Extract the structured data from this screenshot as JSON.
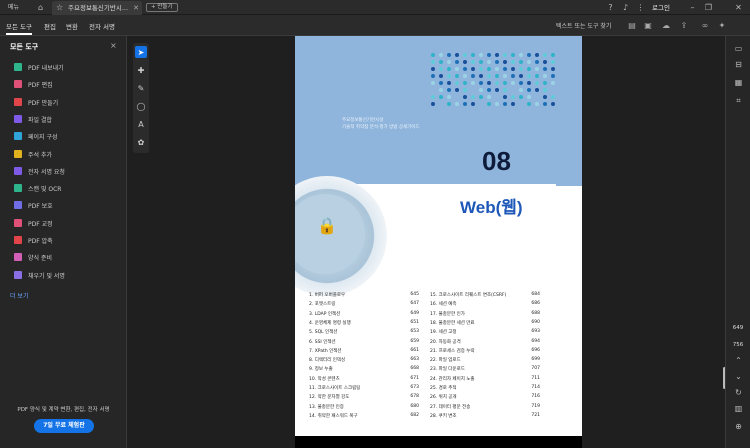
{
  "titlebar": {
    "menu_label": "메뉴",
    "tab_title": "주요정보통신기반시...",
    "new_label": "+ 만들기",
    "login_label": "로그인"
  },
  "toolbar": {
    "tabs": [
      "모든 도구",
      "편집",
      "변환",
      "전자 서명"
    ],
    "search_label": "텍스트 또는 도구 찾기"
  },
  "sidebar": {
    "title": "모든 도구",
    "items": [
      {
        "label": "PDF 내보내기",
        "color": "#2fb58b"
      },
      {
        "label": "PDF 편집",
        "color": "#e0517a"
      },
      {
        "label": "PDF 만들기",
        "color": "#e0454a"
      },
      {
        "label": "파일 결합",
        "color": "#7f5ae6"
      },
      {
        "label": "페이지 구성",
        "color": "#2fa4d8"
      },
      {
        "label": "주석 추가",
        "color": "#e0b21e"
      },
      {
        "label": "전자 서명 요청",
        "color": "#7f5ae6"
      },
      {
        "label": "스캔 및 OCR",
        "color": "#2fb58b"
      },
      {
        "label": "PDF 보호",
        "color": "#6f6ee6"
      },
      {
        "label": "PDF 교정",
        "color": "#e0517a"
      },
      {
        "label": "PDF 압축",
        "color": "#e0454a"
      },
      {
        "label": "양식 준비",
        "color": "#d15fb6"
      },
      {
        "label": "채우기 및 서명",
        "color": "#8a6ee6"
      }
    ],
    "more_label": "더 보기",
    "promo_text": "PDF 양식 및 계약 변환, 편집, 전자 서명",
    "trial_button": "7일 무료 체험판"
  },
  "page": {
    "category_line1": "주요정보통신기반시설",
    "category_line2": "기술적 취약점 분석·평가 방법 상세가이드",
    "chapter_number": "08",
    "chapter_title": "Web(웹)",
    "toc_left": [
      {
        "t": "1. 버퍼 오버플로우",
        "p": "645"
      },
      {
        "t": "2. 포맷스트링",
        "p": "647"
      },
      {
        "t": "3. LDAP 인젝션",
        "p": "649"
      },
      {
        "t": "4. 운영체제 명령 실행",
        "p": "651"
      },
      {
        "t": "5. SQL 인젝션",
        "p": "653"
      },
      {
        "t": "6. SSI 인젝션",
        "p": "659"
      },
      {
        "t": "7. XPath 인젝션",
        "p": "661"
      },
      {
        "t": "8. 디렉터리 인덱싱",
        "p": "663"
      },
      {
        "t": "9. 정보 누출",
        "p": "668"
      },
      {
        "t": "10. 악성 콘텐츠",
        "p": "671"
      },
      {
        "t": "11. 크로스사이트 스크립팅",
        "p": "673"
      },
      {
        "t": "12. 약한 문자열 강도",
        "p": "678"
      },
      {
        "t": "13. 불충분한 인증",
        "p": "680"
      },
      {
        "t": "14. 취약한 패스워드 복구",
        "p": "682"
      }
    ],
    "toc_right": [
      {
        "t": "15. 크로스사이트 리퀘스트 변조(CSRF)",
        "p": "684"
      },
      {
        "t": "16. 세션 예측",
        "p": "686"
      },
      {
        "t": "17. 불충분한 인가",
        "p": "688"
      },
      {
        "t": "18. 불충분한 세션 만료",
        "p": "690"
      },
      {
        "t": "19. 세션 고정",
        "p": "693"
      },
      {
        "t": "20. 자동화 공격",
        "p": "694"
      },
      {
        "t": "21. 프로세스 검증 누락",
        "p": "696"
      },
      {
        "t": "22. 파일 업로드",
        "p": "699"
      },
      {
        "t": "23. 파일 다운로드",
        "p": "707"
      },
      {
        "t": "24. 관리자 페이지 노출",
        "p": "711"
      },
      {
        "t": "25. 경로 추적",
        "p": "714"
      },
      {
        "t": "26. 위치 공개",
        "p": "716"
      },
      {
        "t": "27. 데이터 평문 전송",
        "p": "719"
      },
      {
        "t": "28. 쿠키 변조",
        "p": "721"
      }
    ]
  },
  "rightbar": {
    "current_page": "649",
    "total_pages": "756"
  }
}
